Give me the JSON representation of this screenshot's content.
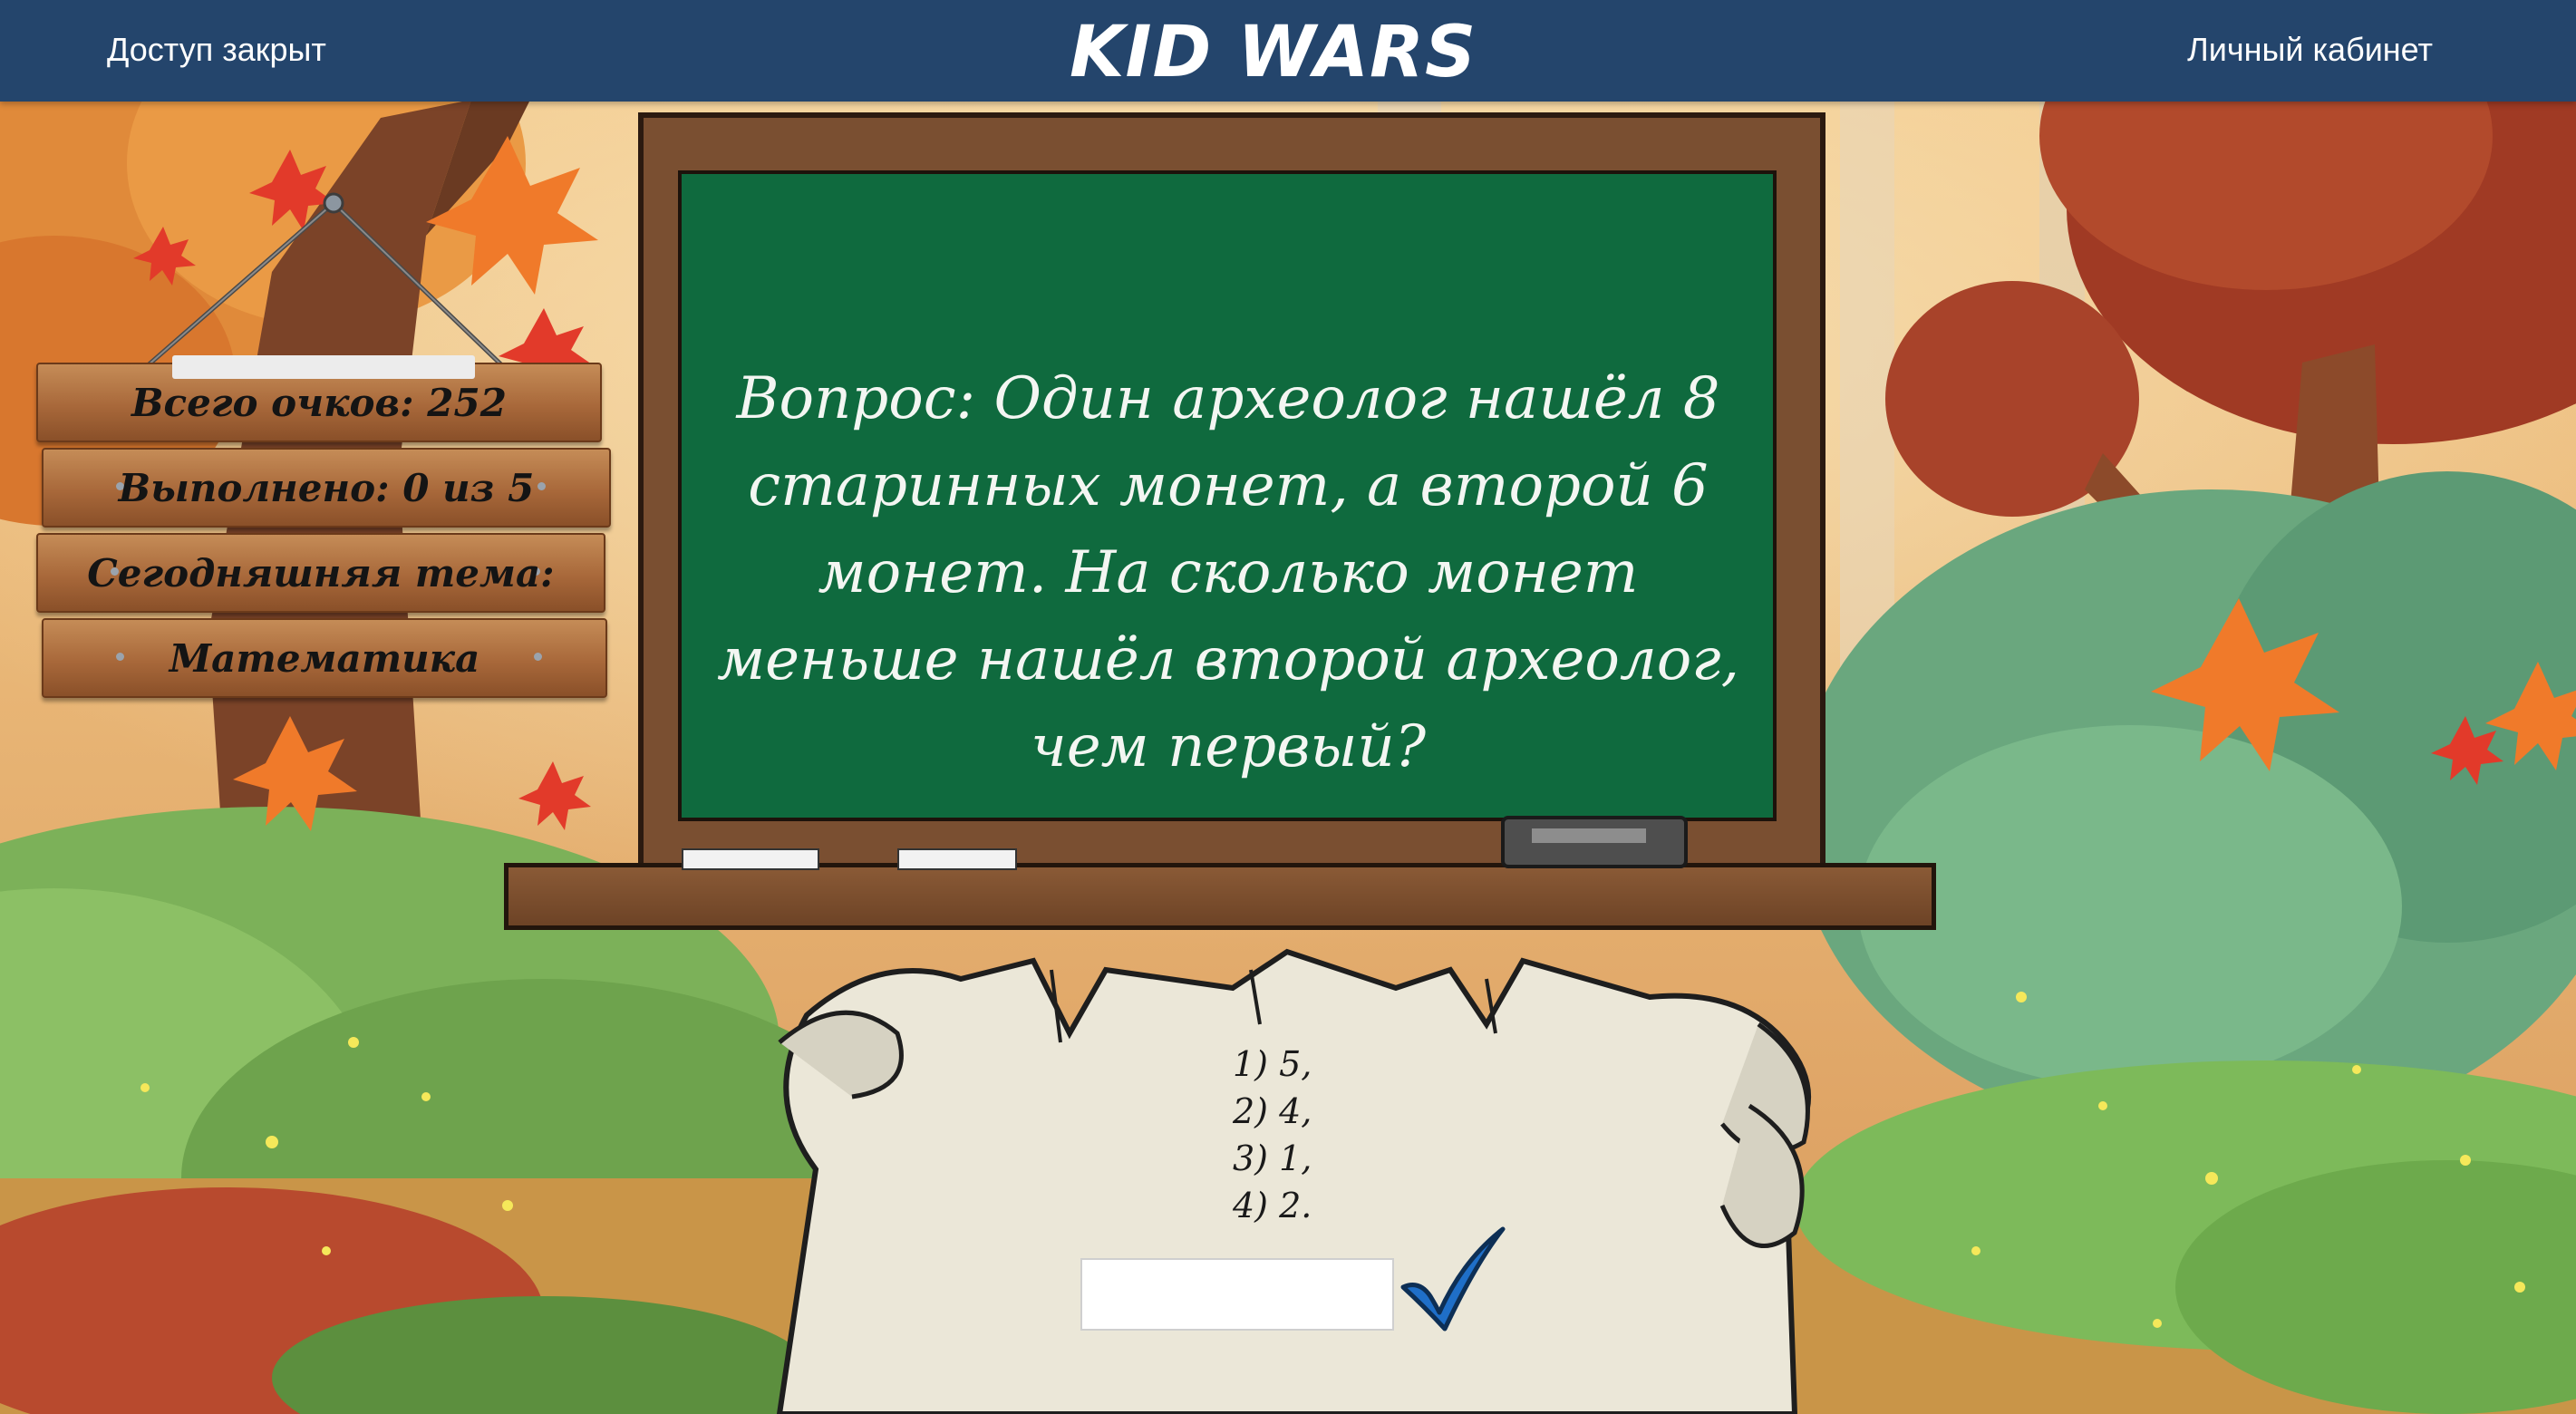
{
  "header": {
    "access_status": "Доступ закрыт",
    "logo": "KID WARS",
    "account_link": "Личный кабинет",
    "bar_color": "#24456c"
  },
  "sign": {
    "total_points": "Всего очков: 252",
    "completed": "Выполнено: 0 из 5",
    "topic_label": "Сегодняшняя тема:",
    "topic_value": "Математика"
  },
  "board": {
    "question": "Вопрос: Один археолог нашёл 8 старинных монет, а второй 6 монет. На сколько монет меньше нашёл второй археолог, чем первый?",
    "board_color": "#0f6a3e"
  },
  "scroll": {
    "options": [
      "1) 5,",
      "2) 4,",
      "3) 1,",
      "4) 2."
    ],
    "answer_value": "",
    "answer_placeholder": ""
  },
  "icons": {
    "submit": "checkmark-icon",
    "leaf": "maple-leaf-icon"
  },
  "colors": {
    "checkmark": "#1f6fc8",
    "chalk": "#f3f6f2"
  }
}
